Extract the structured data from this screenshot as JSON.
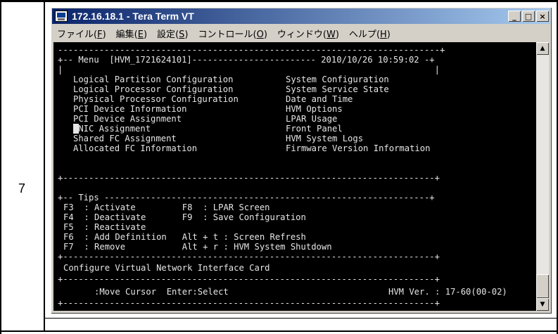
{
  "document": {
    "row_number": "7"
  },
  "window": {
    "title": "172.16.18.1 - Tera Term VT",
    "controls": {
      "minimize": "_",
      "maximize": "□",
      "close": "×"
    }
  },
  "menubar": [
    {
      "label": "ファイル",
      "accel": "F"
    },
    {
      "label": "編集",
      "accel": "E"
    },
    {
      "label": "設定",
      "accel": "S"
    },
    {
      "label": "コントロール",
      "accel": "O"
    },
    {
      "label": "ウィンドウ",
      "accel": "W"
    },
    {
      "label": "ヘルプ",
      "accel": "H"
    }
  ],
  "terminal": {
    "menu_header": "+-- Menu  [HVM_1721624101]------------------------ 2010/10/26 10:59:02 -+",
    "menu_left": [
      "Logical Partition Configuration",
      "Logical Processor Configuration",
      "Physical Processor Configuration",
      "PCI Device Information",
      "PCI Device Assignment",
      "VNIC Assignment",
      "Shared FC Assignment",
      "Allocated FC Information"
    ],
    "menu_right": [
      "System Configuration",
      "System Service State",
      "Date and Time",
      "HVM Options",
      "LPAR Usage",
      "Front Panel",
      "HVM System Logs",
      "Firmware Version Information"
    ],
    "tips_header": "+-- Tips ---------------------------------------------------------------+",
    "tips": [
      "F3  : Activate         F8  : LPAR Screen",
      "F4  : Deactivate       F9  : Save Configuration",
      "F5  : Reactivate",
      "F6  : Add Definition   Alt + t : Screen Refresh",
      "F7  : Remove           Alt + r : HVM System Shutdown"
    ],
    "description": "Configure Virtual Network Interface Card",
    "footer_keys": ":Move Cursor  Enter:Select",
    "footer_version": "HVM Ver. : 17-60(00-02)"
  },
  "scrollbar": {
    "up_icon": "▲",
    "down_icon": "▼"
  }
}
